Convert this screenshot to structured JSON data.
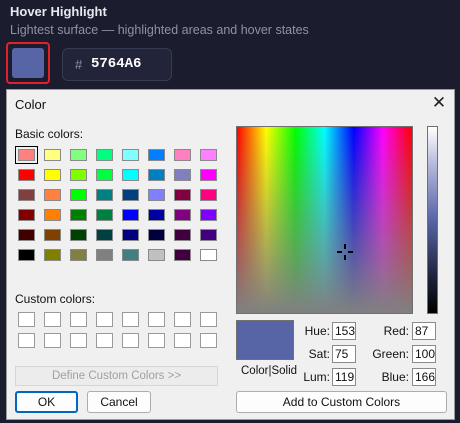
{
  "background": {
    "title": "Hover Highlight",
    "subtitle": "Lightest surface — highlighted areas and hover states",
    "swatch_color": "#5764A6",
    "hash": "#",
    "hex_value": "5764A6"
  },
  "dialog": {
    "title": "Color",
    "close_glyph": "✕",
    "basic_colors_label": "Basic colors:",
    "custom_colors_label": "Custom colors:",
    "basic_colors": [
      "#ff8080",
      "#ffff80",
      "#80ff80",
      "#00ff80",
      "#80ffff",
      "#0080ff",
      "#ff80c0",
      "#ff80ff",
      "#ff0000",
      "#ffff00",
      "#80ff00",
      "#00ff40",
      "#00ffff",
      "#0080c0",
      "#8080c0",
      "#ff00ff",
      "#804040",
      "#ff8040",
      "#00ff00",
      "#008080",
      "#004080",
      "#8080ff",
      "#800040",
      "#ff0080",
      "#800000",
      "#ff8000",
      "#008000",
      "#008040",
      "#0000ff",
      "#0000a0",
      "#800080",
      "#8000ff",
      "#400000",
      "#804000",
      "#004000",
      "#004040",
      "#000080",
      "#000040",
      "#400040",
      "#400080",
      "#000000",
      "#808000",
      "#808040",
      "#808080",
      "#408080",
      "#c0c0c0",
      "#400040",
      "#ffffff"
    ],
    "define_custom_label": "Define Custom Colors >>",
    "ok_label": "OK",
    "cancel_label": "Cancel",
    "color_solid_label": "Color|Solid",
    "add_custom_label": "Add to Custom Colors",
    "preview_color": "#5764A6",
    "hue_label": "Hue:",
    "hue": "153",
    "sat_label": "Sat:",
    "sat": "75",
    "lum_label": "Lum:",
    "lum": "119",
    "red_label": "Red:",
    "red": "87",
    "green_label": "Green:",
    "green": "100",
    "blue_label": "Blue:",
    "blue": "166"
  }
}
